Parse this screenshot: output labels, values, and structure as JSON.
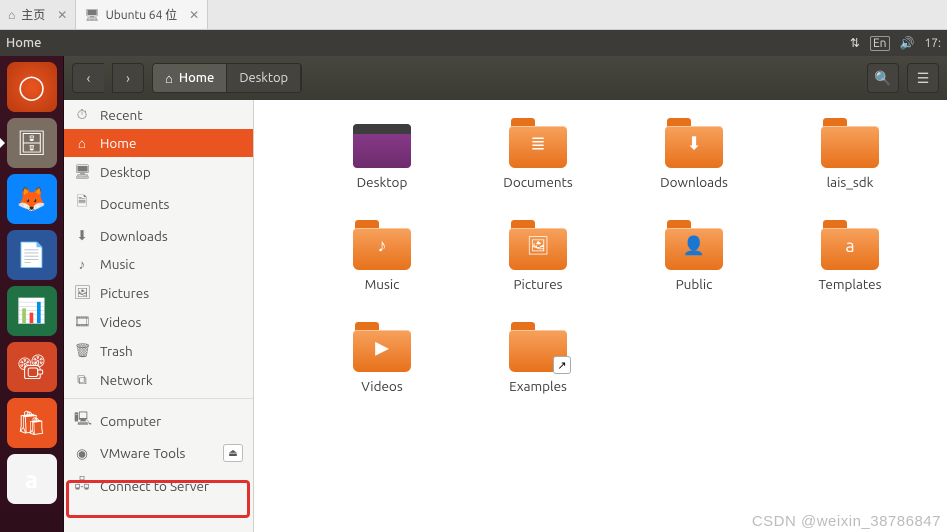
{
  "vmware": {
    "tab_home": "主页",
    "tab_active": "Ubuntu 64 位"
  },
  "menubar": {
    "app": "Home",
    "lang": "En",
    "time": "17:"
  },
  "toolbar": {
    "home_label": "Home",
    "desktop_label": "Desktop"
  },
  "sidebar": {
    "items": [
      {
        "icon": "⏱",
        "label": "Recent"
      },
      {
        "icon": "⌂",
        "label": "Home",
        "selected": true
      },
      {
        "icon": "🖥",
        "label": "Desktop"
      },
      {
        "icon": "🗎",
        "label": "Documents"
      },
      {
        "icon": "⬇",
        "label": "Downloads"
      },
      {
        "icon": "♪",
        "label": "Music"
      },
      {
        "icon": "🖼",
        "label": "Pictures"
      },
      {
        "icon": "🎞",
        "label": "Videos"
      },
      {
        "icon": "🗑",
        "label": "Trash"
      },
      {
        "icon": "⧉",
        "label": "Network"
      }
    ],
    "devices": [
      {
        "icon": "🖳",
        "label": "Computer"
      },
      {
        "icon": "◉",
        "label": "VMware Tools",
        "eject": true
      },
      {
        "icon": "🖧",
        "label": "Connect to Server"
      }
    ]
  },
  "files": [
    {
      "name": "Desktop",
      "type": "desktop"
    },
    {
      "name": "Documents",
      "type": "folder",
      "glyph": "≣"
    },
    {
      "name": "Downloads",
      "type": "folder",
      "glyph": "⬇"
    },
    {
      "name": "lais_sdk",
      "type": "folder",
      "glyph": ""
    },
    {
      "name": "Music",
      "type": "folder",
      "glyph": "♪"
    },
    {
      "name": "Pictures",
      "type": "folder",
      "glyph": "🖼"
    },
    {
      "name": "Public",
      "type": "folder",
      "glyph": "👤"
    },
    {
      "name": "Templates",
      "type": "folder",
      "glyph": "a"
    },
    {
      "name": "Videos",
      "type": "folder",
      "glyph": "▶"
    },
    {
      "name": "Examples",
      "type": "folder-link",
      "glyph": ""
    }
  ],
  "watermark": "CSDN @weixin_38786847"
}
